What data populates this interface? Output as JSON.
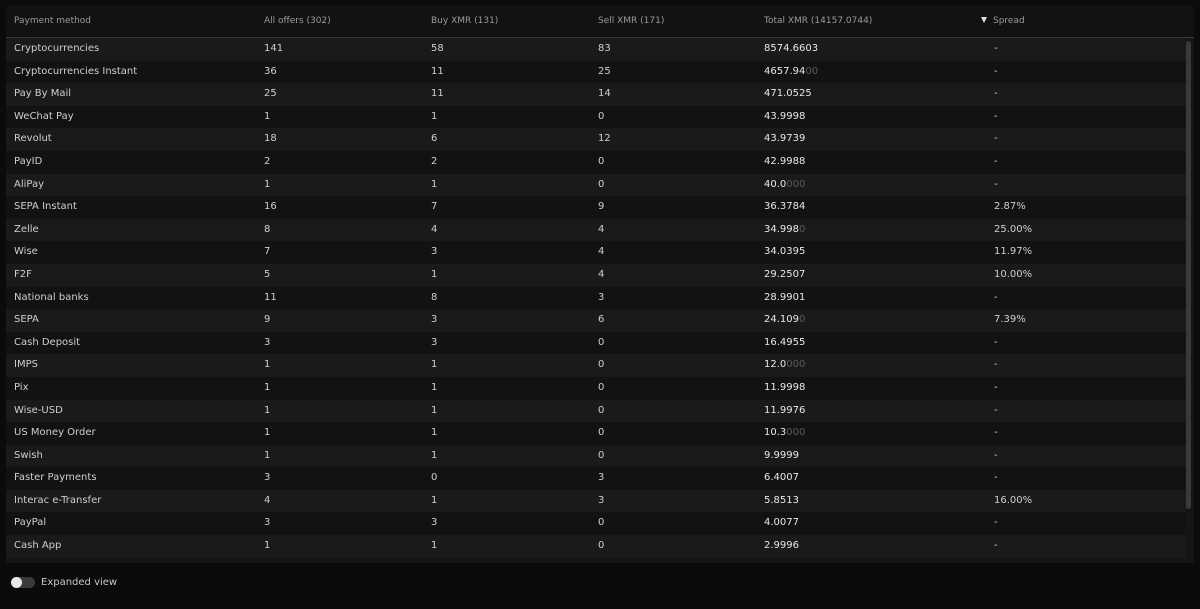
{
  "header": {
    "payment_method": "Payment method",
    "all_offers": "All offers (302)",
    "buy_xmr": "Buy XMR (131)",
    "sell_xmr": "Sell XMR (171)",
    "total_xmr": "Total XMR (14157.0744)",
    "spread": "Spread"
  },
  "rows": [
    {
      "method": "Cryptocurrencies",
      "all": "141",
      "buy": "58",
      "sell": "83",
      "total_main": "8574.6603",
      "total_dim": "",
      "spread": "-"
    },
    {
      "method": "Cryptocurrencies Instant",
      "all": "36",
      "buy": "11",
      "sell": "25",
      "total_main": "4657.94",
      "total_dim": "00",
      "spread": "-"
    },
    {
      "method": "Pay By Mail",
      "all": "25",
      "buy": "11",
      "sell": "14",
      "total_main": "471.0525",
      "total_dim": "",
      "spread": "-"
    },
    {
      "method": "WeChat Pay",
      "all": "1",
      "buy": "1",
      "sell": "0",
      "total_main": "43.9998",
      "total_dim": "",
      "spread": "-"
    },
    {
      "method": "Revolut",
      "all": "18",
      "buy": "6",
      "sell": "12",
      "total_main": "43.9739",
      "total_dim": "",
      "spread": "-"
    },
    {
      "method": "PayID",
      "all": "2",
      "buy": "2",
      "sell": "0",
      "total_main": "42.9988",
      "total_dim": "",
      "spread": "-"
    },
    {
      "method": "AliPay",
      "all": "1",
      "buy": "1",
      "sell": "0",
      "total_main": "40.0",
      "total_dim": "000",
      "spread": "-"
    },
    {
      "method": "SEPA Instant",
      "all": "16",
      "buy": "7",
      "sell": "9",
      "total_main": "36.3784",
      "total_dim": "",
      "spread": "2.87%"
    },
    {
      "method": "Zelle",
      "all": "8",
      "buy": "4",
      "sell": "4",
      "total_main": "34.998",
      "total_dim": "0",
      "spread": "25.00%"
    },
    {
      "method": "Wise",
      "all": "7",
      "buy": "3",
      "sell": "4",
      "total_main": "34.0395",
      "total_dim": "",
      "spread": "11.97%"
    },
    {
      "method": "F2F",
      "all": "5",
      "buy": "1",
      "sell": "4",
      "total_main": "29.2507",
      "total_dim": "",
      "spread": "10.00%"
    },
    {
      "method": "National banks",
      "all": "11",
      "buy": "8",
      "sell": "3",
      "total_main": "28.9901",
      "total_dim": "",
      "spread": "-"
    },
    {
      "method": "SEPA",
      "all": "9",
      "buy": "3",
      "sell": "6",
      "total_main": "24.109",
      "total_dim": "0",
      "spread": "7.39%"
    },
    {
      "method": "Cash Deposit",
      "all": "3",
      "buy": "3",
      "sell": "0",
      "total_main": "16.4955",
      "total_dim": "",
      "spread": "-"
    },
    {
      "method": "IMPS",
      "all": "1",
      "buy": "1",
      "sell": "0",
      "total_main": "12.0",
      "total_dim": "000",
      "spread": "-"
    },
    {
      "method": "Pix",
      "all": "1",
      "buy": "1",
      "sell": "0",
      "total_main": "11.9998",
      "total_dim": "",
      "spread": "-"
    },
    {
      "method": "Wise-USD",
      "all": "1",
      "buy": "1",
      "sell": "0",
      "total_main": "11.9976",
      "total_dim": "",
      "spread": "-"
    },
    {
      "method": "US Money Order",
      "all": "1",
      "buy": "1",
      "sell": "0",
      "total_main": "10.3",
      "total_dim": "000",
      "spread": "-"
    },
    {
      "method": "Swish",
      "all": "1",
      "buy": "1",
      "sell": "0",
      "total_main": "9.9999",
      "total_dim": "",
      "spread": "-"
    },
    {
      "method": "Faster Payments",
      "all": "3",
      "buy": "0",
      "sell": "3",
      "total_main": "6.4007",
      "total_dim": "",
      "spread": "-"
    },
    {
      "method": "Interac e-Transfer",
      "all": "4",
      "buy": "1",
      "sell": "3",
      "total_main": "5.8513",
      "total_dim": "",
      "spread": "16.00%"
    },
    {
      "method": "PayPal",
      "all": "3",
      "buy": "3",
      "sell": "0",
      "total_main": "4.0077",
      "total_dim": "",
      "spread": "-"
    },
    {
      "method": "Cash App",
      "all": "1",
      "buy": "1",
      "sell": "0",
      "total_main": "2.9996",
      "total_dim": "",
      "spread": "-"
    }
  ],
  "footer": {
    "expanded_view_label": "Expanded view",
    "expanded_view_on": false
  },
  "sort": {
    "column": "spread",
    "direction": "descending",
    "icon": "sort-desc-icon"
  },
  "colors": {
    "background": "#0b0b0b",
    "row_odd": "#1a1a1a",
    "row_even": "#121212",
    "text": "#cfcfcf",
    "dim_digits": "#5a5a5a"
  }
}
